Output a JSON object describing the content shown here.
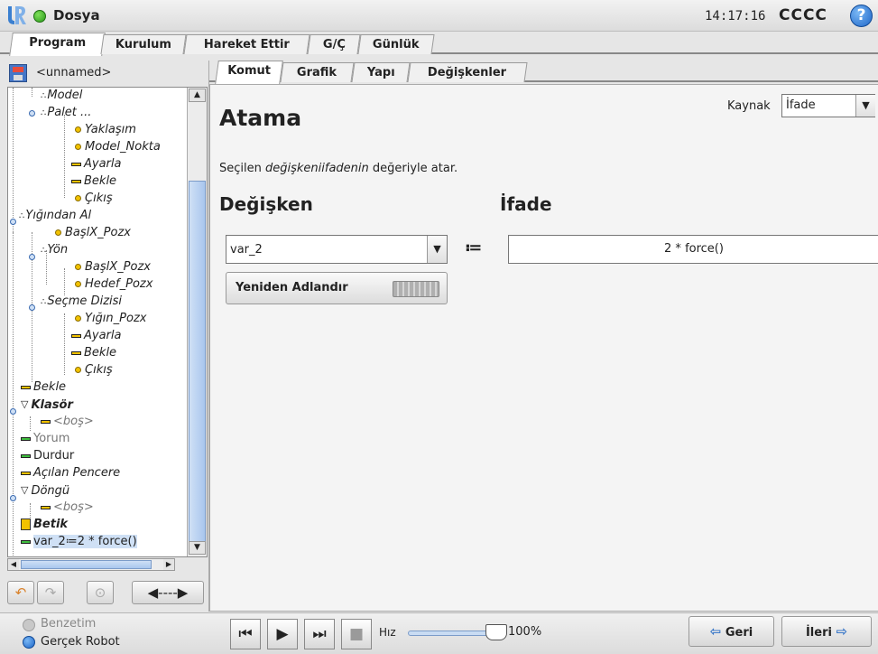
{
  "topbar": {
    "file_menu": "Dosya",
    "clock": "14:17:16",
    "robot_name": "CCCC",
    "help": "?"
  },
  "main_tabs": [
    "Program",
    "Kurulum",
    "Hareket Ettir",
    "G/Ç",
    "Günlük"
  ],
  "program": {
    "name": "<unnamed>"
  },
  "tree": [
    {
      "label": "Model",
      "style": "italic",
      "icon": "waypoint-group"
    },
    {
      "label": "Palet ...",
      "style": "italic",
      "icon": "waypoint-group"
    },
    {
      "label": "Yaklaşım",
      "style": "italic",
      "icon": "dot"
    },
    {
      "label": "Model_Nokta",
      "style": "italic",
      "icon": "dot"
    },
    {
      "label": "Ayarla",
      "style": "italic",
      "icon": "dash"
    },
    {
      "label": "Bekle",
      "style": "italic",
      "icon": "dash"
    },
    {
      "label": "Çıkış",
      "style": "italic",
      "icon": "dot"
    },
    {
      "label": "Yığından Al",
      "style": "italic",
      "icon": "waypoint-group"
    },
    {
      "label": "BaşlX_Pozx",
      "style": "italic",
      "icon": "dot"
    },
    {
      "label": "Yön",
      "style": "italic",
      "icon": "waypoint-group"
    },
    {
      "label": "BaşlX_Pozx",
      "style": "italic",
      "icon": "dot"
    },
    {
      "label": "Hedef_Pozx",
      "style": "italic",
      "icon": "dot"
    },
    {
      "label": "Seçme Dizisi",
      "style": "italic",
      "icon": "waypoint-group"
    },
    {
      "label": "Yığın_Pozx",
      "style": "italic",
      "icon": "dot"
    },
    {
      "label": "Ayarla",
      "style": "italic",
      "icon": "dash"
    },
    {
      "label": "Bekle",
      "style": "italic",
      "icon": "dash"
    },
    {
      "label": "Çıkış",
      "style": "italic",
      "icon": "dot"
    },
    {
      "label": "Bekle",
      "style": "italic",
      "icon": "dash"
    },
    {
      "label": "Klasör",
      "style": "bold-italic",
      "icon": "folder"
    },
    {
      "label": "<boş>",
      "style": "gray-italic",
      "icon": "dash"
    },
    {
      "label": "Yorum",
      "style": "gray",
      "icon": "dash-green"
    },
    {
      "label": "Durdur",
      "style": "plain",
      "icon": "dash-green"
    },
    {
      "label": "Açılan Pencere",
      "style": "italic",
      "icon": "dash"
    },
    {
      "label": "Döngü",
      "style": "italic",
      "icon": "folder"
    },
    {
      "label": "<boş>",
      "style": "gray-italic",
      "icon": "dash"
    },
    {
      "label": "Betik",
      "style": "bold-italic",
      "icon": "script"
    },
    {
      "label": "var_2≔2 * force()",
      "style": "plain",
      "icon": "dash-green"
    }
  ],
  "sub_tabs": [
    "Komut",
    "Grafik",
    "Yapı",
    "Değişkenler"
  ],
  "command": {
    "source_label": "Kaynak",
    "source_value": "İfade",
    "title": "Atama",
    "description_pre": "Seçilen ",
    "description_em": "değişkeniifadenin",
    "description_post": " değeriyle atar.",
    "variable_heading": "Değişken",
    "expression_heading": "İfade",
    "variable_value": "var_2",
    "assign_operator": "≔",
    "expression_value": "2 * force()",
    "rename_label": "Yeniden Adlandır"
  },
  "bottombar": {
    "simulation_label": "Benzetim",
    "real_robot_label": "Gerçek Robot",
    "speed_label": "Hız",
    "speed_value": "100%",
    "speed_fraction": 1.0,
    "back_label": "Geri",
    "next_label": "İleri"
  }
}
